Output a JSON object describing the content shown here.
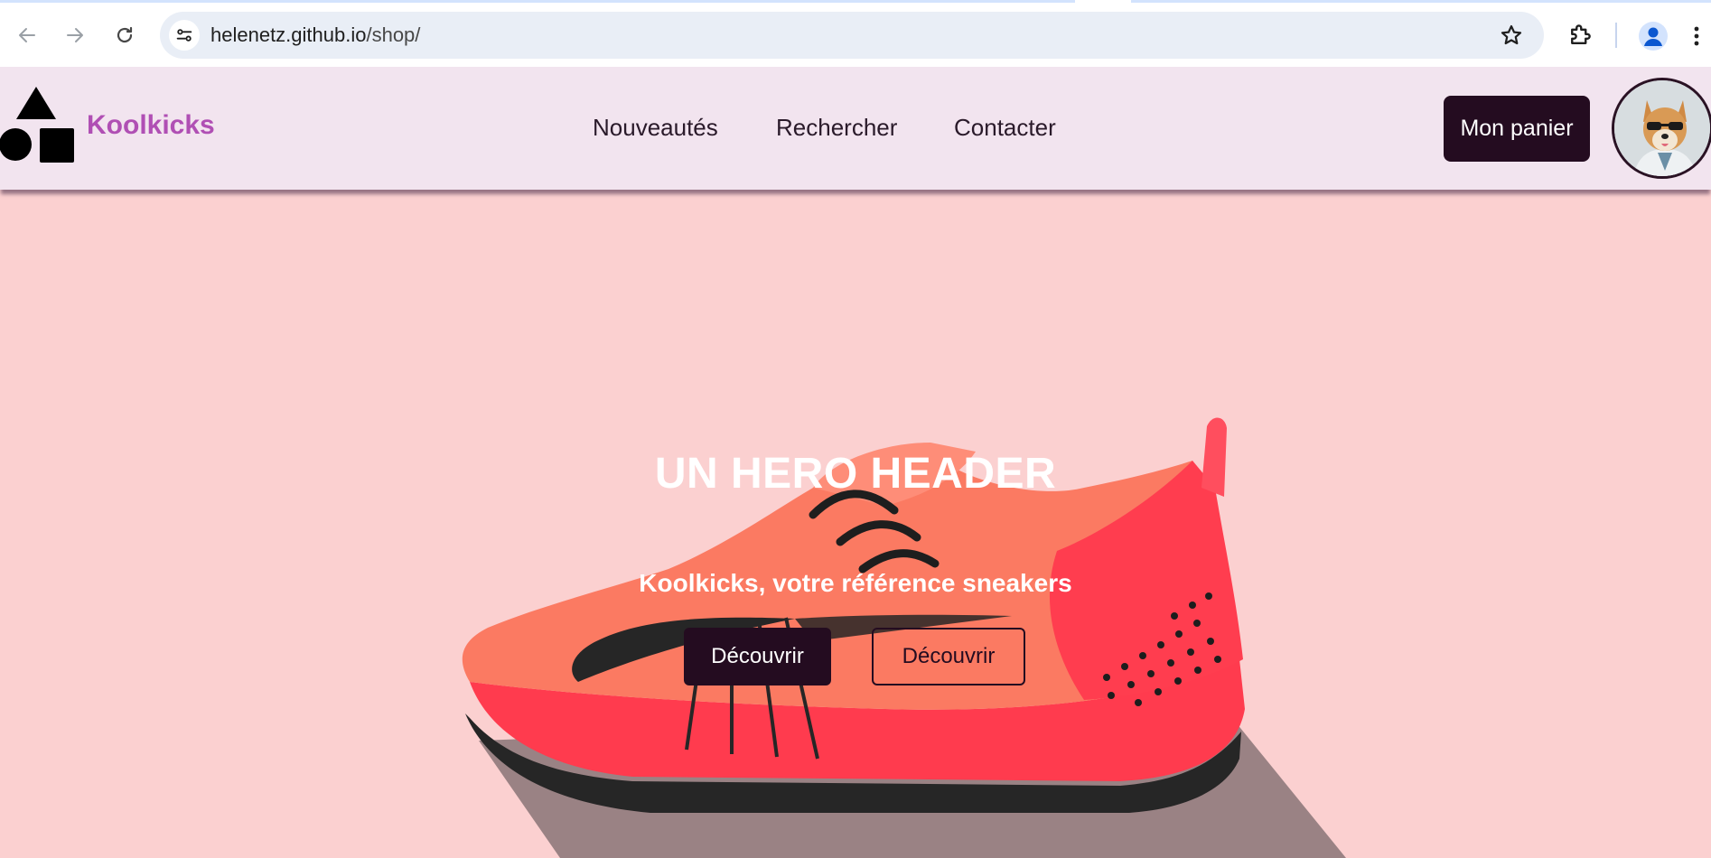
{
  "browser": {
    "url_host": "helenetz.github.io",
    "url_path": "/shop/",
    "icons": {
      "back": "arrow-left-icon",
      "forward": "arrow-right-icon",
      "reload": "reload-icon",
      "site_info": "tune-icon",
      "bookmark": "star-icon",
      "extensions": "puzzle-icon",
      "profile": "person-icon",
      "menu": "kebab-menu-icon"
    }
  },
  "header": {
    "brand": "Koolkicks",
    "nav": [
      "Nouveautés",
      "Rechercher",
      "Contacter"
    ],
    "cart_label": "Mon panier",
    "logo_icon": "shapes-logo-icon",
    "avatar_icon": "dog-avatar-icon"
  },
  "hero": {
    "title": "UN HERO HEADER",
    "subtitle": "Koolkicks, votre référence sneakers",
    "primary_button": "Découvrir",
    "secondary_button": "Découvrir",
    "image_icon": "sneaker-image"
  },
  "colors": {
    "header_bg": "#f2e4ef",
    "brand": "#b04fb4",
    "hero_bg": "#fbd0d0",
    "dark_button": "#240c20",
    "shoe_primary": "#ff3d4f",
    "shoe_upper": "#fb7a62"
  }
}
